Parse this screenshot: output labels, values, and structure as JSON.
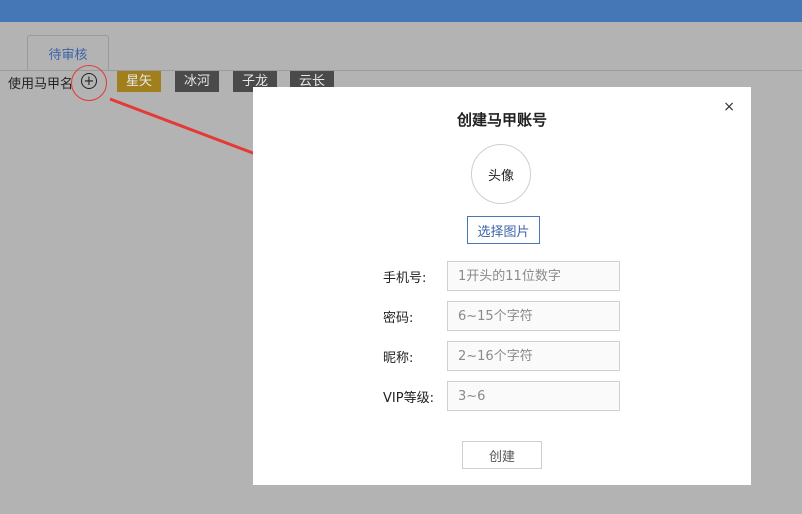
{
  "header": {
    "color": "#4576b5"
  },
  "tabs": [
    {
      "label": "待审核",
      "active": true
    }
  ],
  "vest": {
    "label": "使用马甲名",
    "add_symbol": "+",
    "tags": [
      {
        "name": "星矢",
        "color": "#a07f1c"
      },
      {
        "name": "冰河",
        "color": "#4a4a4a"
      },
      {
        "name": "子龙",
        "color": "#4a4a4a"
      },
      {
        "name": "云长",
        "color": "#4a4a4a"
      }
    ]
  },
  "modal": {
    "title": "创建马甲账号",
    "close_symbol": "×",
    "avatar_label": "头像",
    "pick_image_label": "选择图片",
    "fields": [
      {
        "label": "手机号:",
        "placeholder": "1开头的11位数字",
        "value": ""
      },
      {
        "label": "密码:",
        "placeholder": "6~15个字符",
        "value": ""
      },
      {
        "label": "昵称:",
        "placeholder": "2~16个字符",
        "value": ""
      },
      {
        "label": "VIP等级:",
        "placeholder": "3~6",
        "value": ""
      }
    ],
    "submit_label": "创建"
  },
  "annotation": {
    "color": "#e53935"
  }
}
